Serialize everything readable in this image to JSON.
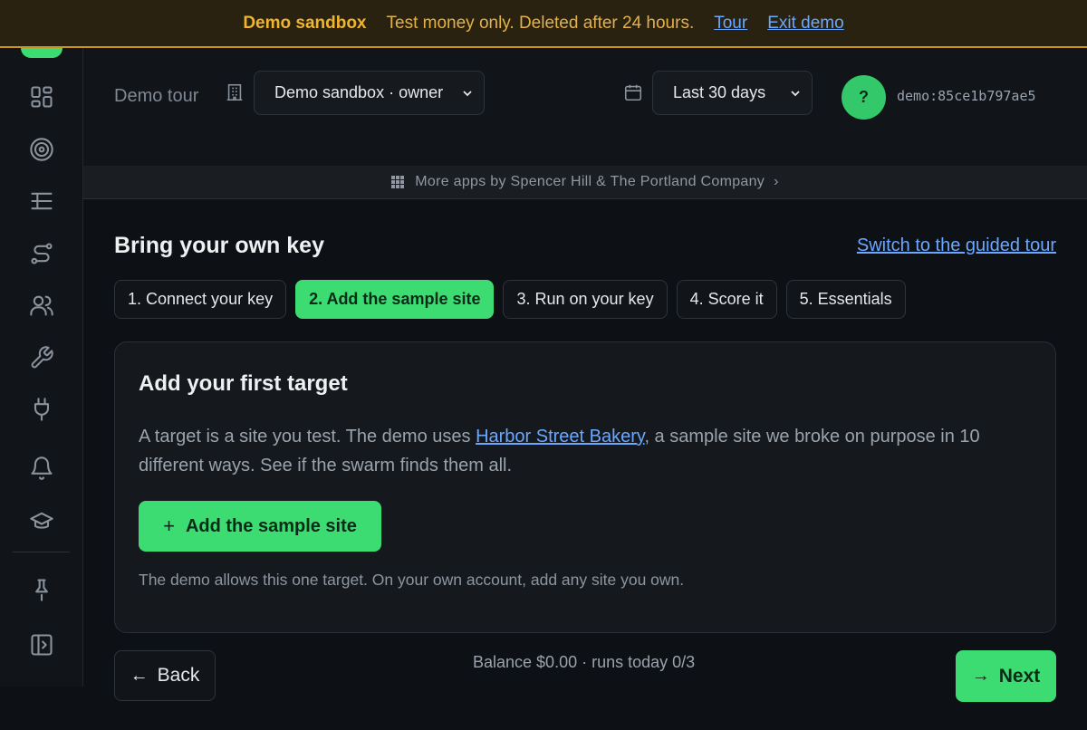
{
  "banner": {
    "title": "Demo sandbox",
    "message": "Test money only. Deleted after 24 hours.",
    "tour_link": "Tour",
    "exit_link": "Exit demo"
  },
  "sidebar": {
    "items": [
      {
        "icon": "dashboard-icon"
      },
      {
        "icon": "target-icon"
      },
      {
        "icon": "list-tree-icon"
      },
      {
        "icon": "route-icon"
      },
      {
        "icon": "users-icon"
      },
      {
        "icon": "wrench-icon"
      },
      {
        "icon": "plug-icon"
      },
      {
        "icon": "bell-icon"
      },
      {
        "icon": "graduation-cap-icon"
      },
      {
        "icon": "pin-icon"
      },
      {
        "icon": "sign-out-icon"
      }
    ]
  },
  "header": {
    "workspace_label": "Demo tour",
    "workspace_select": "Demo sandbox · owner",
    "date_range": "Last 30 days",
    "avatar_initial": "?",
    "user_id": "demo:85ce1b797ae5"
  },
  "apps_strip": {
    "label": "More apps by Spencer Hill & The Portland Company",
    "arrow": "›"
  },
  "page": {
    "title": "Bring your own key",
    "guided_link": "Switch to the guided tour"
  },
  "steps": [
    {
      "label": "1. Connect your key",
      "active": false
    },
    {
      "label": "2. Add the sample site",
      "active": true
    },
    {
      "label": "3. Run on your key",
      "active": false
    },
    {
      "label": "4. Score it",
      "active": false
    },
    {
      "label": "5. Essentials",
      "active": false
    }
  ],
  "card": {
    "title": "Add your first target",
    "desc_before": "A target is a site you test. The demo uses ",
    "desc_link": "Harbor Street Bakery",
    "desc_after": ", a sample site we broke on purpose in 10 different ways. See if the swarm finds them all.",
    "add_button": "Add the sample site",
    "note": "The demo allows this one target. On your own account, add any site you own."
  },
  "footer": {
    "back": "Back",
    "balance": "Balance $0.00 · runs today 0/3",
    "next": "Next"
  },
  "colors": {
    "accent": "#3ddc72",
    "banner_bg": "#2a2210",
    "banner_title": "#f1b42f",
    "link": "#6aa7ff"
  }
}
